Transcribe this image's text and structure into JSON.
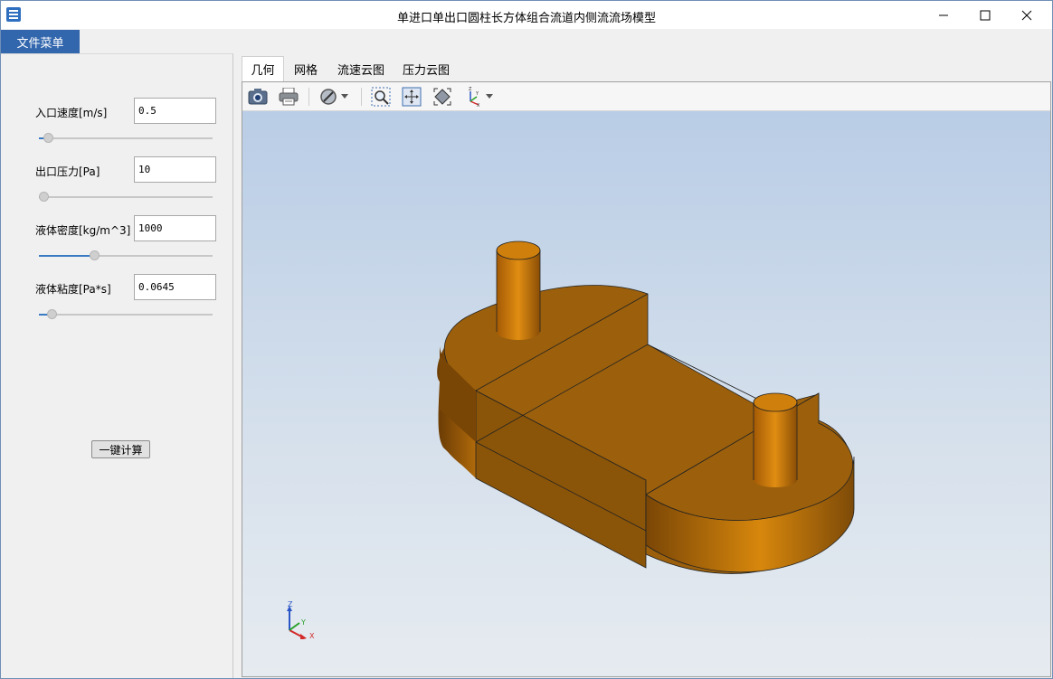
{
  "window": {
    "title": "单进口单出口圆柱长方体组合流道内侧流流场模型"
  },
  "titlebar": {
    "app_icon": "app-icon",
    "minimize_icon": "minimize-icon",
    "maximize_icon": "maximize-icon",
    "close_icon": "close-icon"
  },
  "menu": {
    "file_label": "文件菜单"
  },
  "params": [
    {
      "label": "入口速度[m/s]",
      "value": "0.5",
      "slider_fraction": 0.03
    },
    {
      "label": "出口压力[Pa]",
      "value": "10",
      "slider_fraction": 0.0
    },
    {
      "label": "液体密度[kg/m^3]",
      "value": "1000",
      "slider_fraction": 0.31
    },
    {
      "label": "液体粘度[Pa*s]",
      "value": "0.0645",
      "slider_fraction": 0.05
    }
  ],
  "calc_button": {
    "label": "一键计算"
  },
  "tabs": [
    {
      "label": "几何",
      "active": true
    },
    {
      "label": "网格",
      "active": false
    },
    {
      "label": "流速云图",
      "active": false
    },
    {
      "label": "压力云图",
      "active": false
    }
  ],
  "toolbar": {
    "icons": [
      "camera-icon",
      "print-icon",
      "display-mode-icon",
      "zoom-box-icon",
      "fit-all-icon",
      "fit-view-icon",
      "axes-orientation-icon"
    ]
  },
  "axes": {
    "x": "X",
    "y": "Y",
    "z": "Z"
  },
  "colors": {
    "accent": "#3266ad",
    "model": "#d7870c",
    "model_dark": "#9a5f0c"
  }
}
